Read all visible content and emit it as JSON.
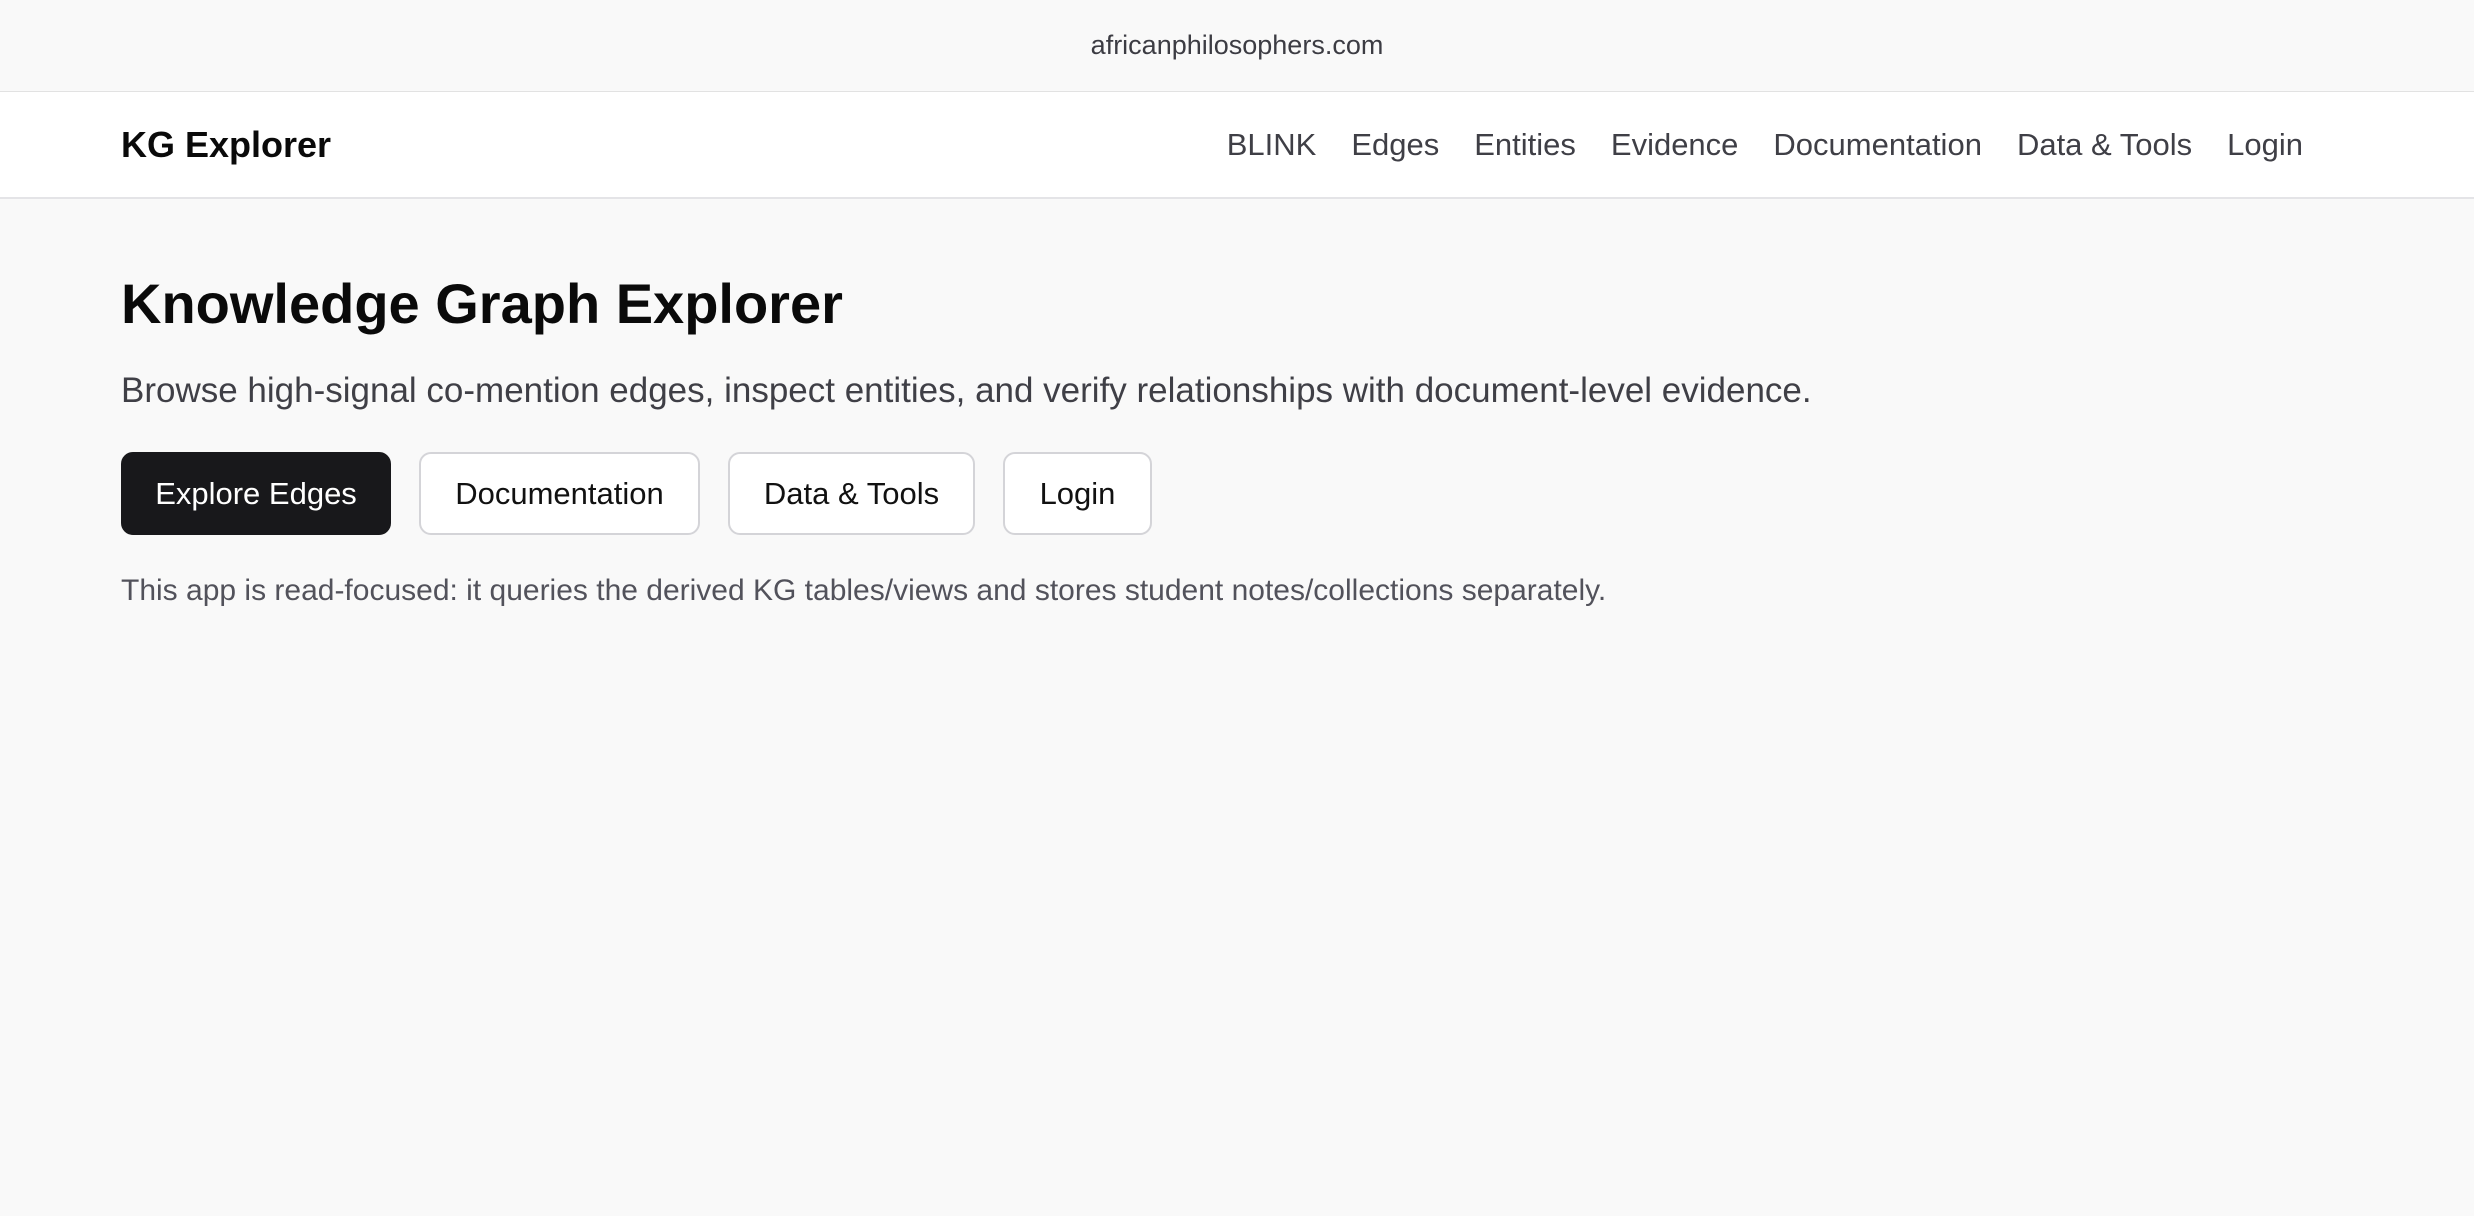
{
  "browser": {
    "url": "africanphilosophers.com"
  },
  "navbar": {
    "brand": "KG Explorer",
    "links": [
      "BLINK",
      "Edges",
      "Entities",
      "Evidence",
      "Documentation",
      "Data & Tools",
      "Login"
    ]
  },
  "main": {
    "title": "Knowledge Graph Explorer",
    "subtitle": "Browse high-signal co-mention edges, inspect entities, and verify relationships with document-level evidence.",
    "buttons": {
      "primary": "Explore Edges",
      "documentation": "Documentation",
      "data_tools": "Data & Tools",
      "login": "Login"
    },
    "note": "This app is read-focused: it queries the derived KG tables/views and stores student notes/collections separately."
  },
  "colors": {
    "page_background": "#f9f9f9",
    "primary_button": "#18181b",
    "text_muted": "#52525b"
  }
}
